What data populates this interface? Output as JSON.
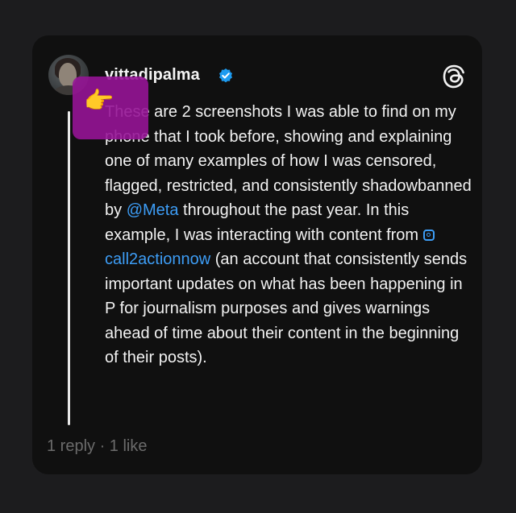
{
  "post": {
    "username": "vittadipalma",
    "verified": true,
    "text_intro": "These are 2 screenshots I was able to find on my phone that I took before, showing and explaining one of many examples of how I was censored, flagged, restricted, and consistently shadowbanned by ",
    "mention_meta": "@Meta",
    "text_middle": " throughout the past year. In this example, I was interacting with content from ",
    "mention_ig": "call2actionnow",
    "text_end": " (an account that consistently sends important updates on what has been happening in P for journalism purposes and gives warnings ahead of time about their content in the beginning of their posts).",
    "emoji": "👉",
    "footer": "1 reply · 1 like"
  },
  "icons": {
    "avatar": "avatar",
    "verified": "verified-badge-icon",
    "logo": "threads-logo-icon",
    "instagram": "instagram-icon"
  },
  "colors": {
    "background": "#1c1c1e",
    "card": "#101010",
    "text": "#f2f2f2",
    "link": "#3d9df6",
    "muted": "#6b6b6b",
    "overlay": "#961496"
  }
}
